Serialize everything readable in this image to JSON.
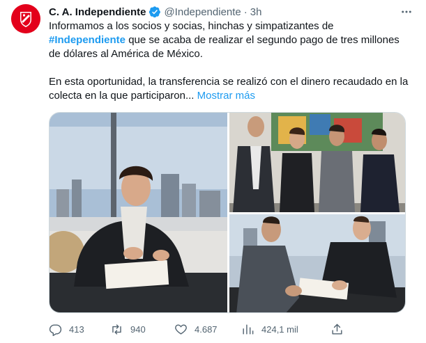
{
  "tweet": {
    "author_name": "C. A. Independiente",
    "handle": "@Independiente",
    "separator": "·",
    "time": "3h",
    "text_line1_pre": "Informamos a los socios y socias, hinchas y simpatizantes de",
    "hashtag": "#Independiente",
    "text_line1_post": " que se acaba de realizar el segundo pago de tres millones de dólares al América de México.",
    "text_p2": "En esta oportunidad, la transferencia se realizó con el dinero recaudado en la colecta en la que participaron... ",
    "show_more": "Mostrar más"
  },
  "icons": {
    "avatar": "independiente-crest-icon",
    "verified": "verified-badge-icon",
    "more": "more-options-icon",
    "reply": "reply-icon",
    "retweet": "retweet-icon",
    "like": "heart-icon",
    "views": "views-chart-icon",
    "share": "share-icon"
  },
  "actions": {
    "replies": "413",
    "retweets": "940",
    "likes": "4.687",
    "views": "424,1 mil"
  },
  "colors": {
    "brand_red": "#e3001b",
    "link_blue": "#1d9bf0",
    "muted": "#536471"
  }
}
